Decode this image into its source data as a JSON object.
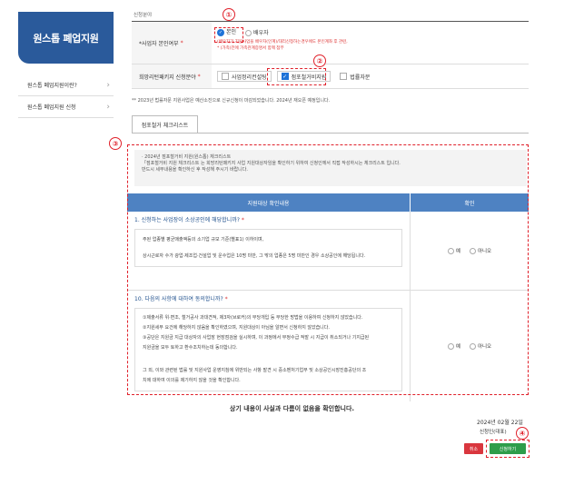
{
  "sidebar": {
    "title": "원스톱 폐업지원",
    "items": [
      {
        "label": "원스톱 폐업지원이란?"
      },
      {
        "label": "원스톱 폐업지원 신청"
      }
    ]
  },
  "section_label": "신청분야",
  "form": {
    "row1": {
      "label": "*사업자 본인여부",
      "req": "*",
      "options": [
        "본인",
        "배우자"
      ],
      "note1": "(배우자가 지원사업을 배우자(인계)/대리신청하는경우에도 본인계좌 후 관련,",
      "note2": "* (가족)전에 가족관계증명서 함께 첨부"
    },
    "row2": {
      "label": "희망리턴패키지 신청분야",
      "req": "*",
      "options": [
        "사업정리컨설팅",
        "점포철거비지원",
        "법률자문"
      ]
    }
  },
  "notice": "** 2023년 법률자문 지원사업은 예산소진으로 신규신청이 마감되었습니다. 2024년 재오픈 예정입니다.",
  "tab_label": "점포철거 체크리스트",
  "info": {
    "line1": "· 2024년 점포철거비 지원(원스톱) 체크리스트",
    "line2": "「점포철거비 지원 체크리스트 는 희망리턴패키지 사업 지원대상자임을 확인하기 위하여 신청인께서 직접 작성하시는 체크리스트 입니다.",
    "line3": "반드시 세부내용을 확인하신 후 작성해 주시기 바랍니다."
  },
  "check_table": {
    "header_left": "지원대상 확인내용",
    "header_right": "확인",
    "yes": "예",
    "no": "아니오",
    "q1": {
      "title": "1. 신청하는 사업장이 소상공인에 해당합니까?",
      "req": "*",
      "d1": "주된 업종별 평균매출액등의 소기업 규모 기준(별표1) 이하이며,",
      "d2": "상시근로자 수가 광업·제조업·건설업 및 운수업은 10명 미만, 그 밖의 업종은 5명 미만인 경우 소상공인에 해당됩니다."
    },
    "q10": {
      "title": "10. 다음의 사항에 대하여 동의합니까?",
      "req": "*",
      "d1": "①제출서류 위·변조, 철거공사 과대견적, 제3자(브로커)의 부당개입 등 부당한 방법을 이용하여 신청하지 않았습니다.",
      "d2": "②지원세부 요건에 해당하지 않음을 확인하였으며, 지원대상이 아님을 알면서 신청하지 않았습니다.",
      "d3": "③공단은 지원금 지급 대상자의 사업장 현장점검을 실시하며, 이 과정에서 부정수급 적발 시 지급이 취소되거나 기지급된",
      "d3b": "지원금을 모두 토하고 환수조치하는데 동의합니다.",
      "d4": "그 외, 이와 관련된 법률 및 지원사업 운영지침에 위반되는 사항 발견 시 중소벤처기업부 및 소상공인시장진흥공단의 조",
      "d4b": "치에 대하여 이의를 제기하지 않을 것을 확인합니다."
    }
  },
  "confirm_text": "상기 내용이 사실과 다름이 없음을 확인합니다.",
  "date_text": "2024년 02월 22일",
  "applicant_text": "신청인(대표)",
  "buttons": {
    "cancel": "취소",
    "apply": "신청하기"
  },
  "badges": [
    "①",
    "②",
    "③",
    "④"
  ],
  "colors": {
    "sidebar": "#2a5a9b",
    "table_header": "#4e82c2",
    "annotation": "#e0202a",
    "apply": "#2e9d4a",
    "cancel": "#d9363e"
  }
}
